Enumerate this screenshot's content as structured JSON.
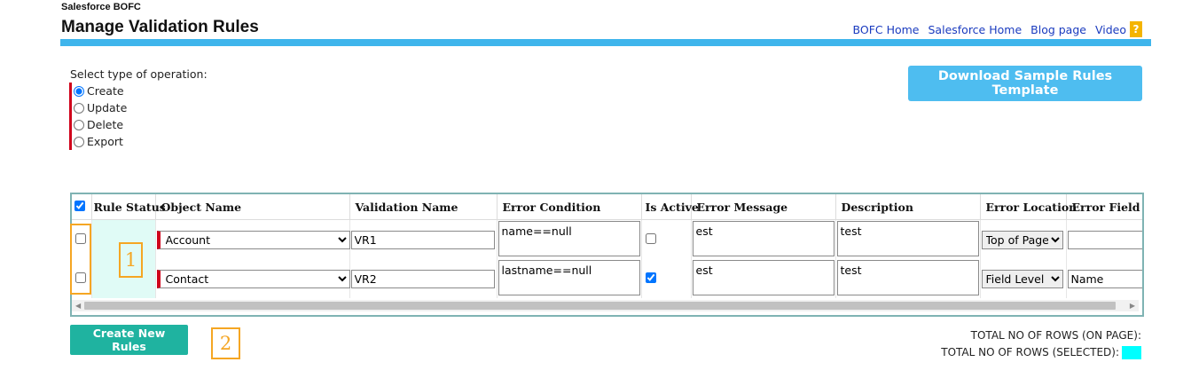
{
  "header": {
    "brand": "Salesforce BOFC",
    "title": "Manage Validation Rules",
    "links": [
      "BOFC Home",
      "Salesforce Home",
      "Blog page",
      "Video"
    ],
    "help_label": "?"
  },
  "operation": {
    "label": "Select type of operation:",
    "options": [
      "Create",
      "Update",
      "Delete",
      "Export"
    ],
    "selected": "Create"
  },
  "download_label": "Download Sample Rules Template",
  "table": {
    "columns": [
      "Rule Status",
      "Object Name",
      "Validation Name",
      "Error Condition",
      "Is Active",
      "Error Message",
      "Description",
      "Error Location",
      "Error Field"
    ],
    "header_select_all": true,
    "rows": [
      {
        "selected": false,
        "object": "Account",
        "validation_name": "VR1",
        "error_condition": "name==null",
        "is_active": false,
        "error_message": "est",
        "description": "test",
        "error_location": "Top of Page",
        "error_field": ""
      },
      {
        "selected": false,
        "object": "Contact",
        "validation_name": "VR2",
        "error_condition": "lastname==null",
        "is_active": true,
        "error_message": "est",
        "description": "test",
        "error_location": "Field Level",
        "error_field": "Name"
      }
    ]
  },
  "annotations": {
    "a1": "1",
    "a2": "2"
  },
  "create_label": "Create New Rules",
  "totals": {
    "on_page": "TOTAL NO OF ROWS (ON PAGE):",
    "selected": "TOTAL NO OF ROWS (SELECTED):"
  },
  "colors": {
    "accent_bar": "#3fb5ec",
    "download_button": "#4ebdf0",
    "create_button": "#1fb3a0",
    "selected_swatch": "#00ffff",
    "annotation": "#f5a623"
  }
}
